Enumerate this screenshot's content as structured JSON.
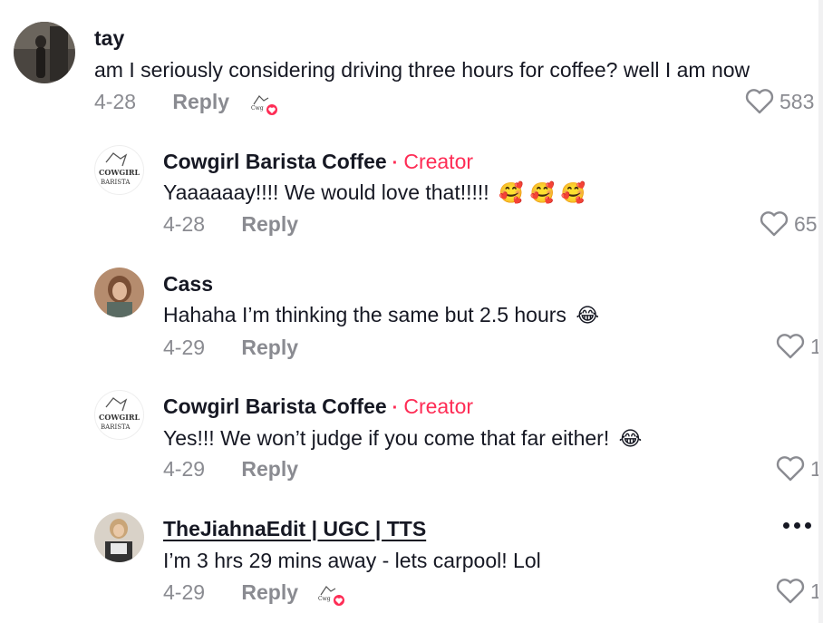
{
  "comments": [
    {
      "username": "tay",
      "text": "am I seriously considering driving three hours for coffee? well I am now",
      "date": "4-28",
      "reply_label": "Reply",
      "likes": "583",
      "creator_liked": true
    },
    {
      "username": "Cowgirl Barista Coffee",
      "creator_label": "Creator",
      "creator_dot": "·",
      "text": "Yaaaaaay!!!! We would love that!!!!!",
      "emojis": "🥰 🥰 🥰",
      "date": "4-28",
      "reply_label": "Reply",
      "likes": "65",
      "avatar_logo_line1": "COWGIRL",
      "avatar_logo_line2": "BARISTA"
    },
    {
      "username": "Cass",
      "text": "Hahaha I’m thinking the same but 2.5 hours",
      "emojis": "😂",
      "date": "4-29",
      "reply_label": "Reply",
      "likes": "1"
    },
    {
      "username": "Cowgirl Barista Coffee",
      "creator_label": "Creator",
      "creator_dot": "·",
      "text": "Yes!!! We won’t judge if you come that far either!",
      "emojis": "😂",
      "date": "4-29",
      "reply_label": "Reply",
      "likes": "1",
      "avatar_logo_line1": "COWGIRL",
      "avatar_logo_line2": "BARISTA"
    },
    {
      "username": "TheJiahnaEdit | UGC | TTS",
      "text": "I’m 3 hrs 29 mins away - lets carpool! Lol",
      "date": "4-29",
      "reply_label": "Reply",
      "likes": "1",
      "creator_liked": true
    }
  ],
  "colors": {
    "accent": "#fe2c55",
    "meta_gray": "#8a8b91",
    "text": "#161823"
  },
  "icons": [
    "heart-outline-icon",
    "creator-liked-badge-icon",
    "more-options-icon"
  ]
}
